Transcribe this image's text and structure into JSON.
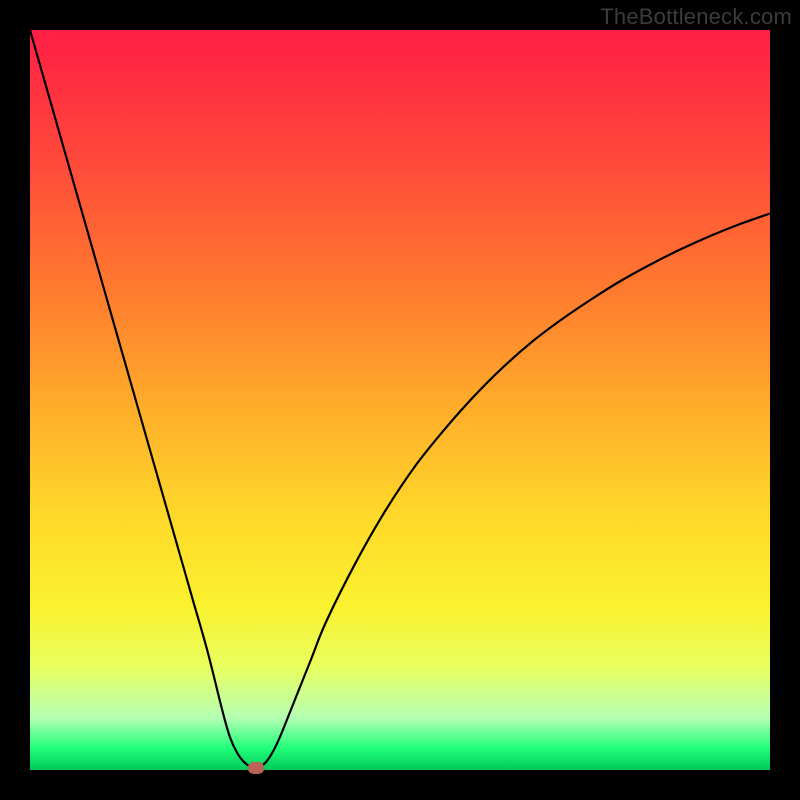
{
  "watermark": "TheBottleneck.com",
  "chart_data": {
    "type": "line",
    "title": "",
    "xlabel": "",
    "ylabel": "",
    "xlim": [
      0,
      100
    ],
    "ylim": [
      0,
      100
    ],
    "curve": {
      "x": [
        0,
        2,
        4,
        6,
        8,
        10,
        12,
        14,
        16,
        18,
        20,
        22,
        24,
        26,
        27,
        28,
        29,
        30,
        31,
        32,
        33,
        34,
        36,
        38,
        40,
        44,
        48,
        52,
        56,
        60,
        64,
        68,
        72,
        76,
        80,
        84,
        88,
        92,
        96,
        100
      ],
      "y": [
        100,
        93,
        86,
        79,
        72,
        65,
        58,
        51,
        44,
        37,
        30,
        23,
        16,
        8,
        4.5,
        2.3,
        1.0,
        0.4,
        0.4,
        1.2,
        2.8,
        5,
        10,
        15,
        20,
        28,
        35,
        41,
        46,
        50.5,
        54.5,
        58,
        61,
        63.7,
        66.2,
        68.4,
        70.4,
        72.2,
        73.8,
        75.2
      ]
    },
    "marker": {
      "x": 30.5,
      "y": 0.3
    },
    "colors": {
      "gradient_top": "#ff1e45",
      "gradient_mid": "#ffd92a",
      "gradient_bottom": "#00c95a",
      "curve": "#000000",
      "marker": "#b96256",
      "frame": "#000000"
    }
  }
}
